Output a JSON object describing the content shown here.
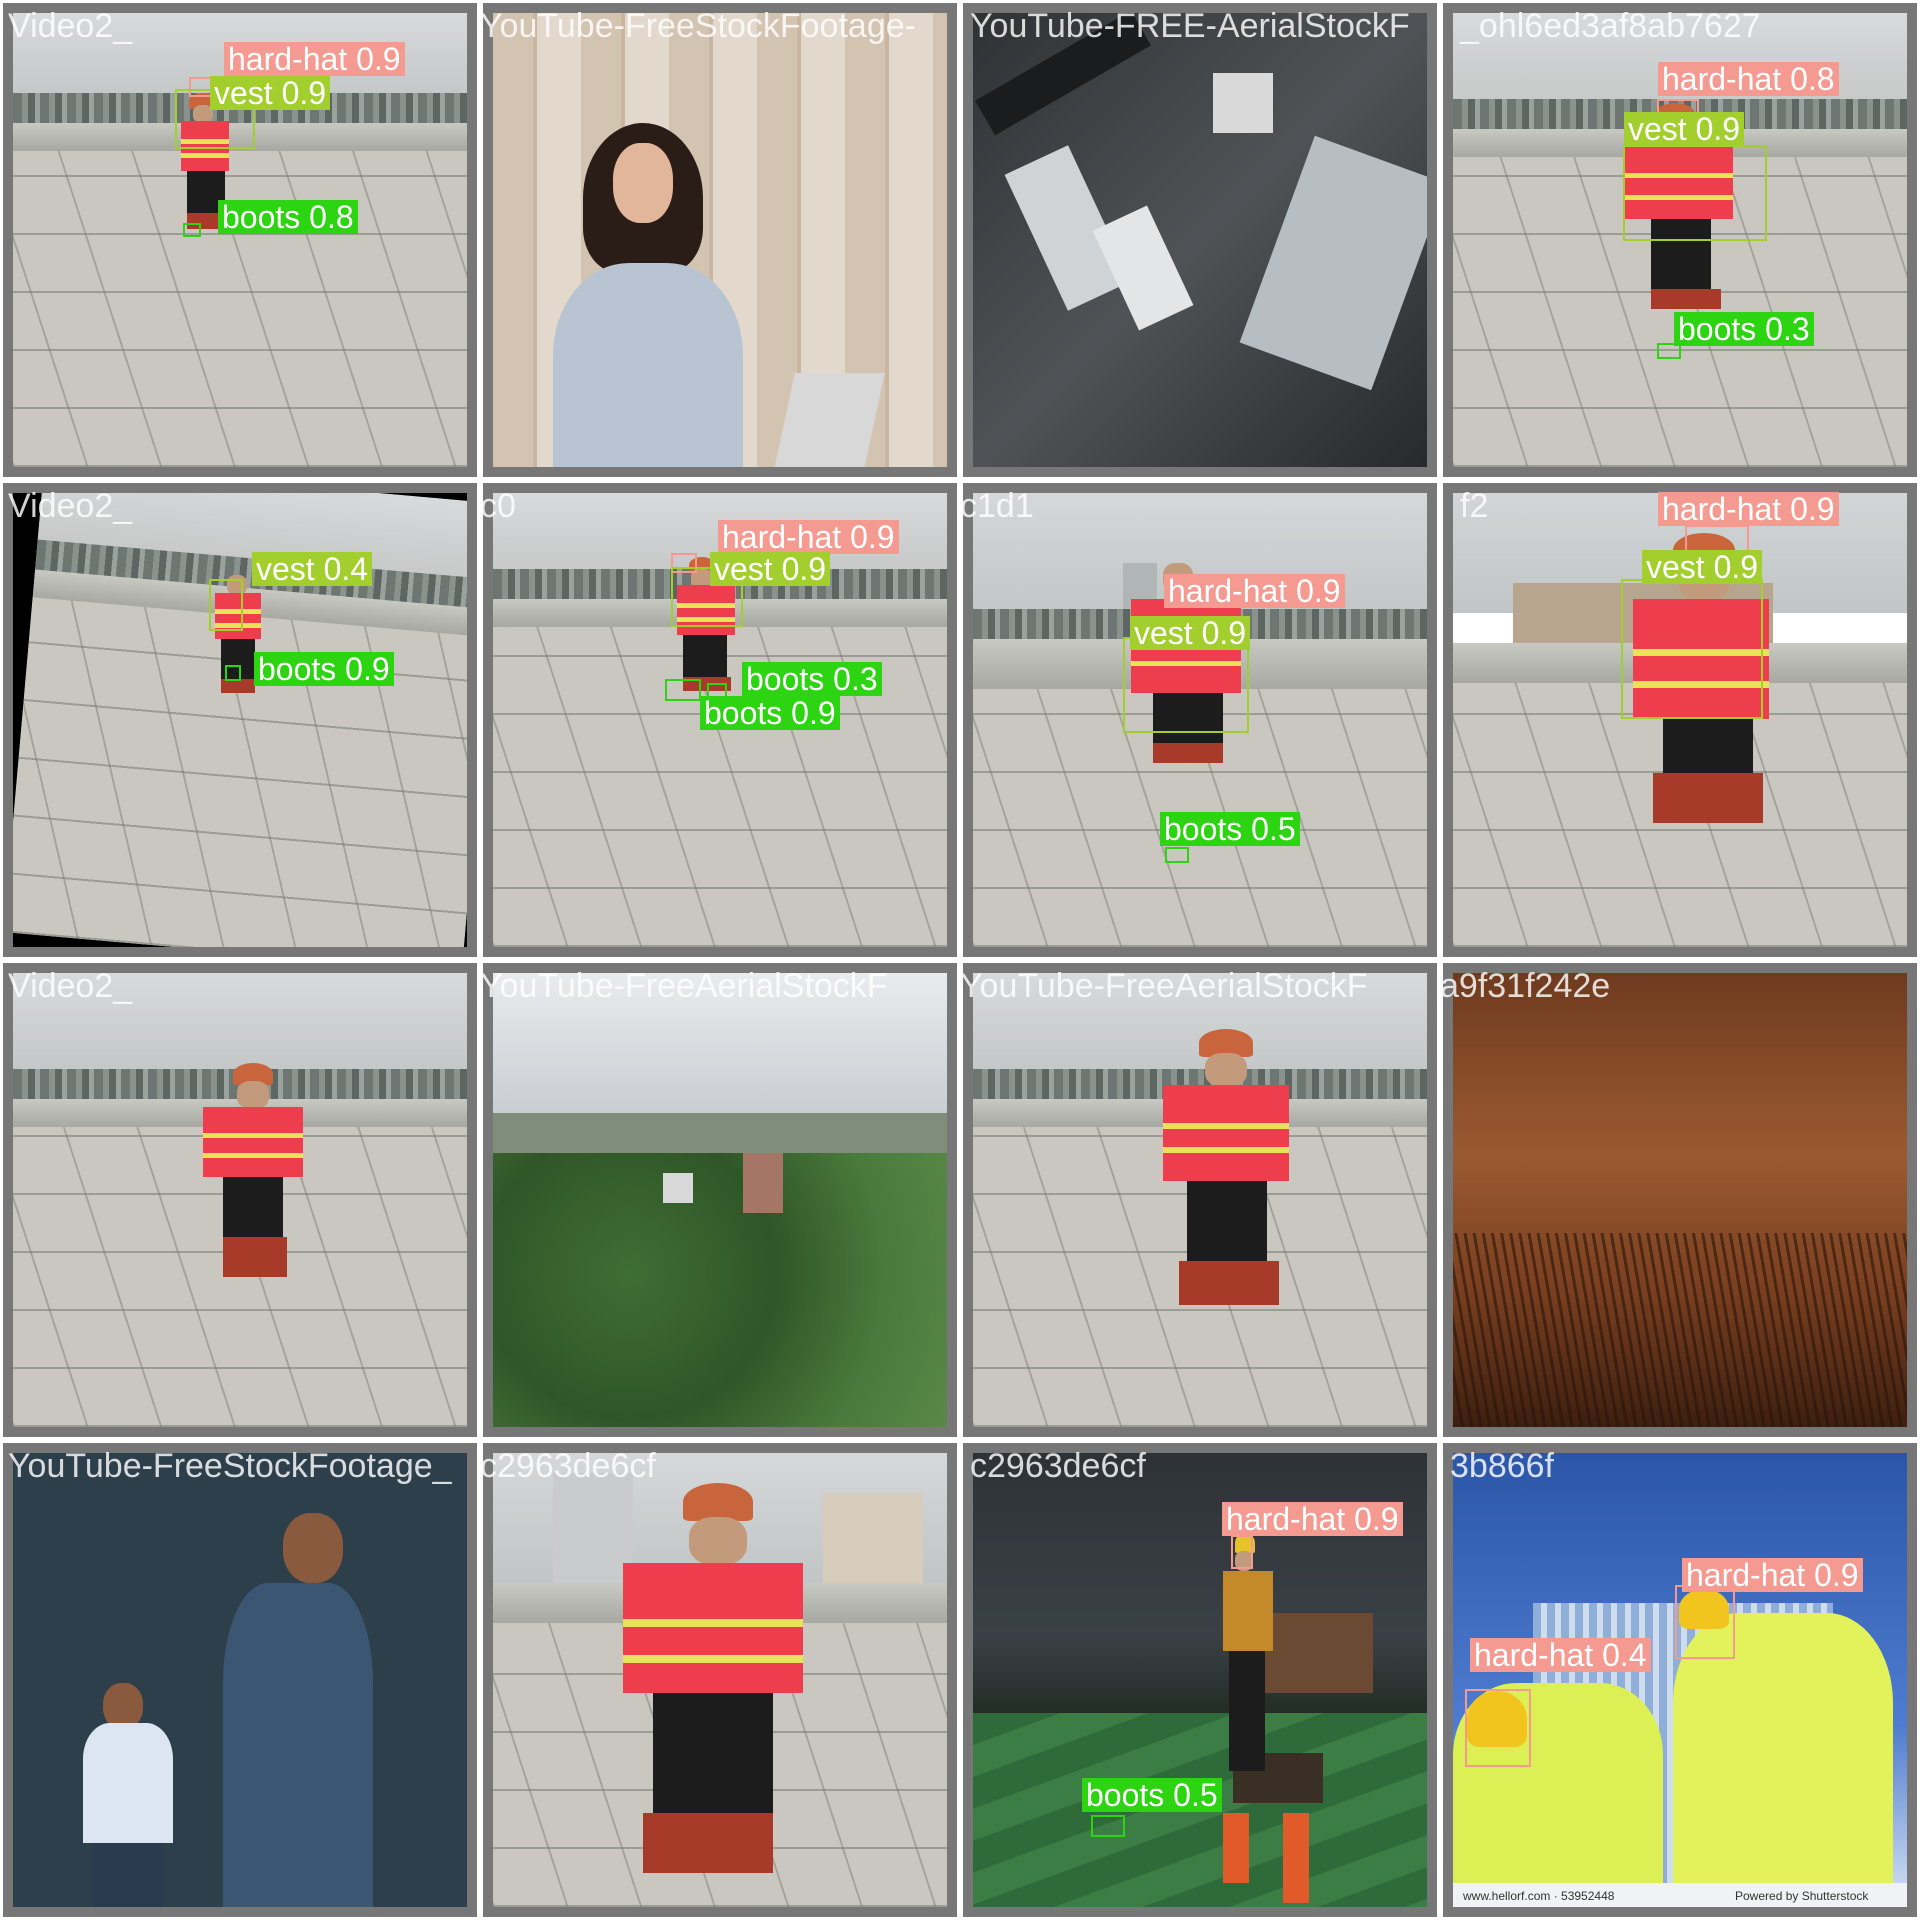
{
  "filenames": {
    "row1": [
      "Video2_",
      "YouTube-FreeStockFootage-",
      "YouTube-FREE-AerialStockF",
      "_ohl6ed3af8ab7627"
    ],
    "row2": [
      "Video2_",
      "c0",
      "c1d1",
      "f2"
    ],
    "row3": [
      "Video2_",
      "YouTube-FreeAerialStockF",
      "a9f31f242e"
    ],
    "row4": [
      "YouTube-FreeStockFootage_",
      "c2963de6cf",
      "3b866f"
    ]
  },
  "detections": [
    {
      "tile": 1,
      "label": "hard-hat 0.9",
      "cls": "hat"
    },
    {
      "tile": 1,
      "label": "vest 0.9",
      "cls": "vest"
    },
    {
      "tile": 1,
      "label": "boots 0.8",
      "cls": "boots"
    },
    {
      "tile": 4,
      "label": "hard-hat 0.8",
      "cls": "hat"
    },
    {
      "tile": 4,
      "label": "vest 0.9",
      "cls": "vest"
    },
    {
      "tile": 4,
      "label": "boots 0.3",
      "cls": "boots"
    },
    {
      "tile": 5,
      "label": "vest 0.4",
      "cls": "vest"
    },
    {
      "tile": 5,
      "label": "boots 0.9",
      "cls": "boots"
    },
    {
      "tile": 6,
      "label": "hard-hat 0.9",
      "cls": "hat"
    },
    {
      "tile": 6,
      "label": "vest 0.9",
      "cls": "vest"
    },
    {
      "tile": 6,
      "label": "boots 0.3",
      "cls": "boots"
    },
    {
      "tile": 6,
      "label": "boots 0.9",
      "cls": "boots"
    },
    {
      "tile": 7,
      "label": "hard-hat 0.9",
      "cls": "hat"
    },
    {
      "tile": 7,
      "label": "vest 0.9",
      "cls": "vest"
    },
    {
      "tile": 7,
      "label": "boots 0.5",
      "cls": "boots"
    },
    {
      "tile": 8,
      "label": "hard-hat 0.9",
      "cls": "hat"
    },
    {
      "tile": 8,
      "label": "vest 0.9",
      "cls": "vest"
    },
    {
      "tile": 15,
      "label": "hard-hat 0.9",
      "cls": "hat"
    },
    {
      "tile": 15,
      "label": "boots 0.5",
      "cls": "boots"
    },
    {
      "tile": 16,
      "label": "hard-hat 0.9",
      "cls": "hat"
    },
    {
      "tile": 16,
      "label": "hard-hat 0.4",
      "cls": "hat"
    }
  ],
  "watermarks": {
    "site": "www.hellorf.com · 53952448",
    "powered": "Powered by Shutterstock"
  },
  "colors": {
    "hard_hat": "#f49a91",
    "vest": "#a2cf2e",
    "boots": "#2cd412",
    "tile_border": "#777777"
  }
}
